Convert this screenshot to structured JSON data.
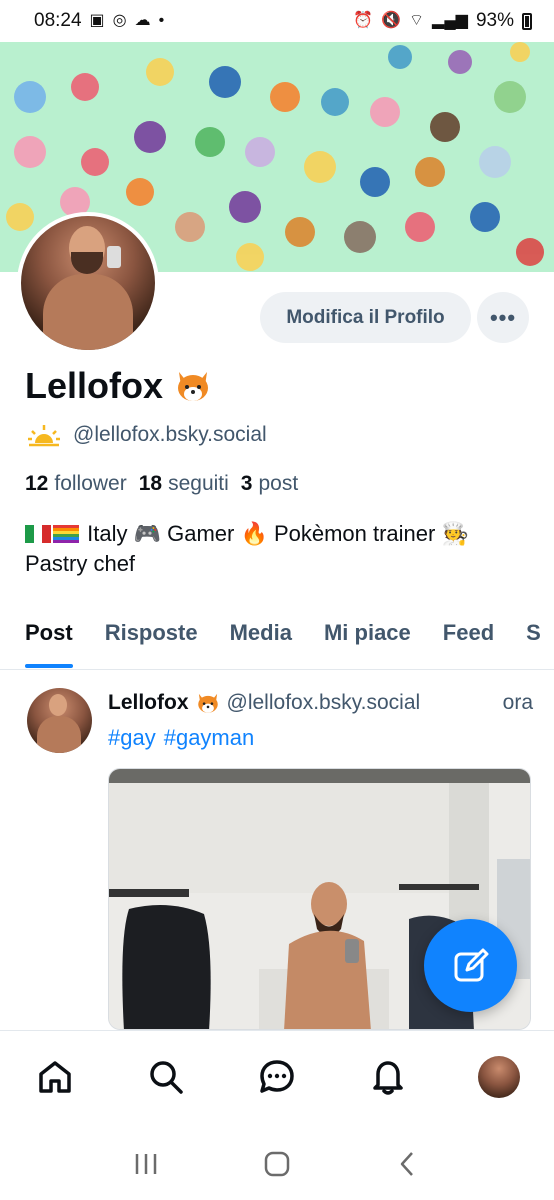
{
  "status_bar": {
    "time": "08:24",
    "battery": "93%"
  },
  "profile": {
    "display_name": "Lellofox",
    "handle": "@lellofox.bsky.social",
    "edit_button": "Modifica il Profilo",
    "more_label": "•••",
    "stats": {
      "followers_count": "12",
      "followers_label": "follower",
      "following_count": "18",
      "following_label": "seguiti",
      "posts_count": "3",
      "posts_label": "post"
    },
    "bio_part1": "Italy 🎮 Gamer 🔥 Pokèmon trainer 🧑‍🍳",
    "bio_part2": "Pastry chef"
  },
  "tabs": [
    {
      "label": "Post",
      "active": true
    },
    {
      "label": "Risposte"
    },
    {
      "label": "Media"
    },
    {
      "label": "Mi piace"
    },
    {
      "label": "Feed"
    },
    {
      "label": "S"
    }
  ],
  "post": {
    "author": "Lellofox",
    "handle": "@lellofox.bsky.social",
    "time": "ora",
    "tags": [
      "#gay",
      "#gayman"
    ]
  },
  "icons": {
    "home": "home-icon",
    "search": "search-icon",
    "chat": "chat-icon",
    "notifications": "bell-icon",
    "compose": "compose-icon"
  },
  "colors": {
    "accent": "#1083fe",
    "banner": "#b9f0cf",
    "muted_text": "#42576c"
  }
}
